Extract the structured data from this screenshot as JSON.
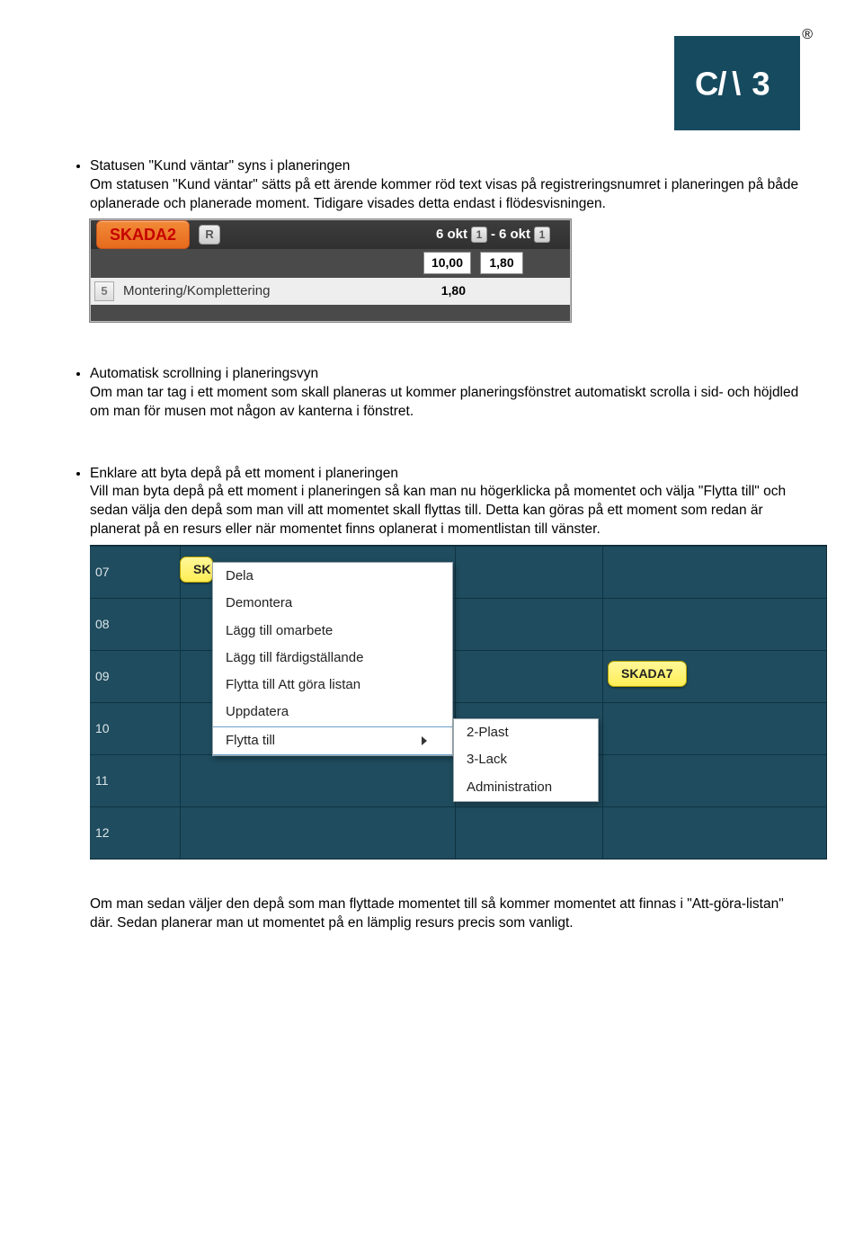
{
  "logo_text": "CAB",
  "sections": [
    {
      "title": "Statusen \"Kund väntar\" syns i planeringen",
      "body": "Om statusen \"Kund väntar\" sätts på ett ärende kommer röd text visas på registreringsnumret i planeringen på både oplanerade och planerade moment. Tidigare visades detta endast i flödesvisningen."
    },
    {
      "title": "Automatisk scrollning i planeringsvyn",
      "body": "Om man tar tag i ett moment som skall planeras ut kommer planeringsfönstret automatiskt scrolla i sid- och höjdled om man för musen mot någon av kanterna i fönstret."
    },
    {
      "title": "Enklare att byta depå på ett moment i planeringen",
      "body": "Vill man byta depå på ett moment i planeringen så kan man nu högerklicka på momentet och välja \"Flytta till\" och sedan välja den depå som man vill att momentet skall flyttas till. Detta kan göras på ett moment som redan är planerat på en resurs eller när momentet finns oplanerat i momentlistan till vänster."
    }
  ],
  "shot1": {
    "badge": "SKADA2",
    "r": "R",
    "date_from": "6 okt",
    "date_from_n": "1",
    "date_sep": "-",
    "date_to": "6 okt",
    "date_to_n": "1",
    "val1": "10,00",
    "val2": "1,80",
    "step_num": "5",
    "step_label": "Montering/Komplettering",
    "step_val": "1,80"
  },
  "shot2": {
    "hours": [
      "07",
      "08",
      "09",
      "10",
      "11",
      "12"
    ],
    "chip1": "SK",
    "chip2": "SKADA7",
    "menu": [
      "Dela",
      "Demontera",
      "Lägg till omarbete",
      "Lägg till färdigställande",
      "Flytta till Att göra listan",
      "Uppdatera",
      "Flytta till"
    ],
    "submenu": [
      "2-Plast",
      "3-Lack",
      "Administration"
    ]
  },
  "conclusion": "Om man sedan väljer den depå som man flyttade momentet till så kommer momentet att finnas i \"Att-göra-listan\" där. Sedan planerar man ut momentet på en lämplig resurs precis som vanligt."
}
